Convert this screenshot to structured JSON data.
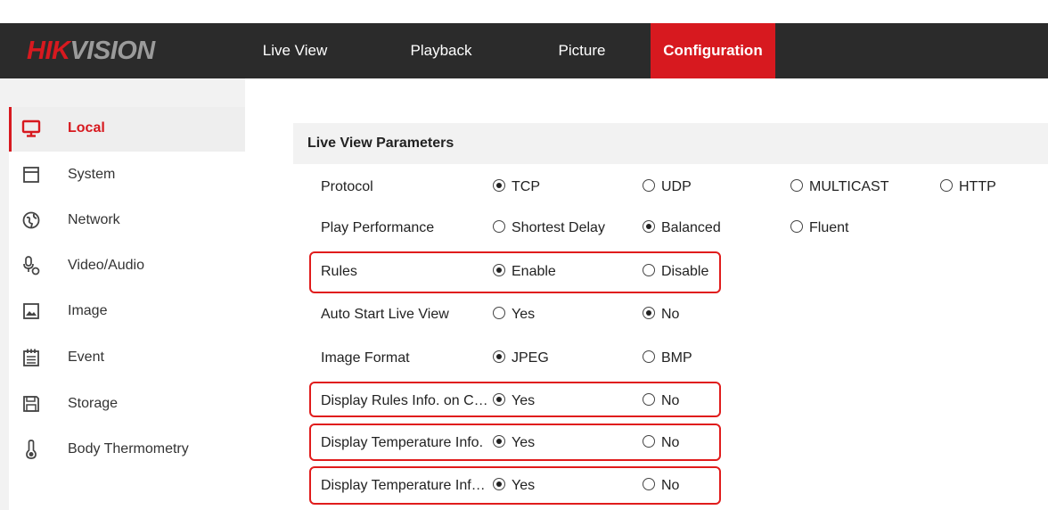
{
  "brand": {
    "hik": "HIK",
    "vision": "VISION"
  },
  "nav": {
    "tabs": [
      {
        "label": "Live View"
      },
      {
        "label": "Playback"
      },
      {
        "label": "Picture"
      },
      {
        "label": "Configuration",
        "active": true
      }
    ]
  },
  "sidebar": {
    "items": [
      {
        "label": "Local",
        "icon": "monitor-icon",
        "active": true
      },
      {
        "label": "System",
        "icon": "system-icon"
      },
      {
        "label": "Network",
        "icon": "network-icon"
      },
      {
        "label": "Video/Audio",
        "icon": "microphone-icon"
      },
      {
        "label": "Image",
        "icon": "image-icon"
      },
      {
        "label": "Event",
        "icon": "calendar-icon"
      },
      {
        "label": "Storage",
        "icon": "save-icon"
      },
      {
        "label": "Body Thermometry",
        "icon": "thermometer-icon"
      }
    ]
  },
  "section": {
    "title": "Live View Parameters"
  },
  "params": [
    {
      "label": "Protocol",
      "options": [
        "TCP",
        "UDP",
        "MULTICAST",
        "HTTP"
      ],
      "selected": "TCP"
    },
    {
      "label": "Play Performance",
      "options": [
        "Shortest Delay",
        "Balanced",
        "Fluent"
      ],
      "selected": "Balanced"
    },
    {
      "label": "Rules",
      "options": [
        "Enable",
        "Disable"
      ],
      "selected": "Enable",
      "highlighted": true
    },
    {
      "label": "Auto Start Live View",
      "options": [
        "Yes",
        "No"
      ],
      "selected": "No"
    },
    {
      "label": "Image Format",
      "options": [
        "JPEG",
        "BMP"
      ],
      "selected": "JPEG"
    },
    {
      "label": "Display Rules Info. on Ca...",
      "options": [
        "Yes",
        "No"
      ],
      "selected": "Yes",
      "highlighted": true
    },
    {
      "label": "Display Temperature Info.",
      "options": [
        "Yes",
        "No"
      ],
      "selected": "Yes",
      "highlighted": true
    },
    {
      "label": "Display Temperature Info...",
      "options": [
        "Yes",
        "No"
      ],
      "selected": "Yes",
      "highlighted": true
    }
  ],
  "colors": {
    "accent": "#d7191f",
    "topbar": "#2b2b2b",
    "highlight": "#e01c1c"
  }
}
